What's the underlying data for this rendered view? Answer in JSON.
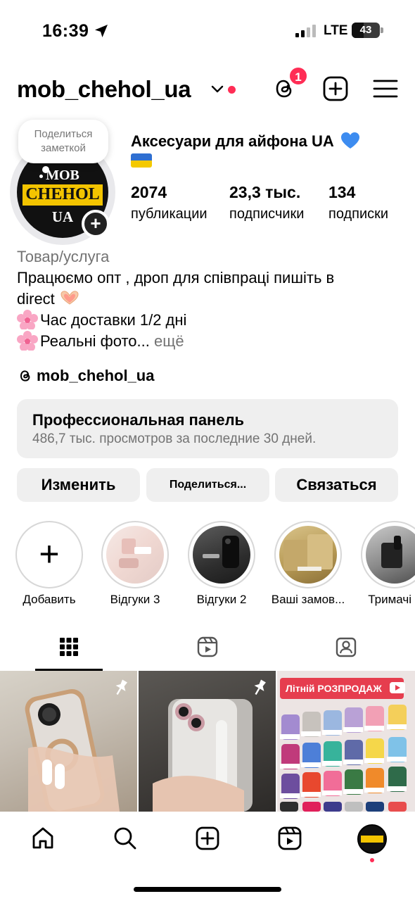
{
  "status_bar": {
    "time": "16:39",
    "network": "LTE",
    "battery": "43",
    "battery_level": 0.43
  },
  "header": {
    "username": "mob_chehol_ua",
    "threads_badge": "1"
  },
  "profile": {
    "note": "Поделиться заметкой",
    "avatar_text": [
      "MOB",
      "CHEHOL",
      "UA"
    ],
    "display_name": "Аксесуари для айфона UA",
    "stats": [
      {
        "value": "2074",
        "label": "публикации"
      },
      {
        "value": "23,3 тыс.",
        "label": "подписчики"
      },
      {
        "value": "134",
        "label": "подписки"
      }
    ],
    "bio": {
      "category": "Товар/услуга",
      "line1": "Працюємо опт , дроп для співпраці пишіть в",
      "line2": "direct",
      "line3": "Час доставки 1/2 дні",
      "line4": "Реальні фото...",
      "more": "ещё"
    },
    "threads_link": "mob_chehol_ua"
  },
  "pro_panel": {
    "title": "Профессиональная панель",
    "subtitle": "486,7 тыс. просмотров за последние 30 дней."
  },
  "actions": {
    "edit": "Изменить",
    "share": "Поделиться...",
    "contact": "Связаться"
  },
  "highlights": [
    {
      "label": "Добавить"
    },
    {
      "label": "Відгуки 3"
    },
    {
      "label": "Відгуки 2"
    },
    {
      "label": "Ваші замов..."
    },
    {
      "label": "Тримачі в"
    }
  ],
  "grid": {
    "sale_banner": "Літній РОЗПРОДАЖ"
  },
  "colors": {
    "accent_red": "#ff2d55",
    "panel_bg": "#efefef",
    "muted_text": "#737373",
    "brand_yellow": "#f3c400"
  },
  "icons": {
    "header": [
      "chevron-down-icon",
      "threads-icon",
      "create-plus-icon",
      "menu-icon"
    ],
    "tabs": [
      "grid-icon",
      "reels-icon",
      "tagged-icon"
    ],
    "nav": [
      "home-icon",
      "search-icon",
      "create-icon",
      "reels-icon",
      "profile-avatar"
    ]
  }
}
